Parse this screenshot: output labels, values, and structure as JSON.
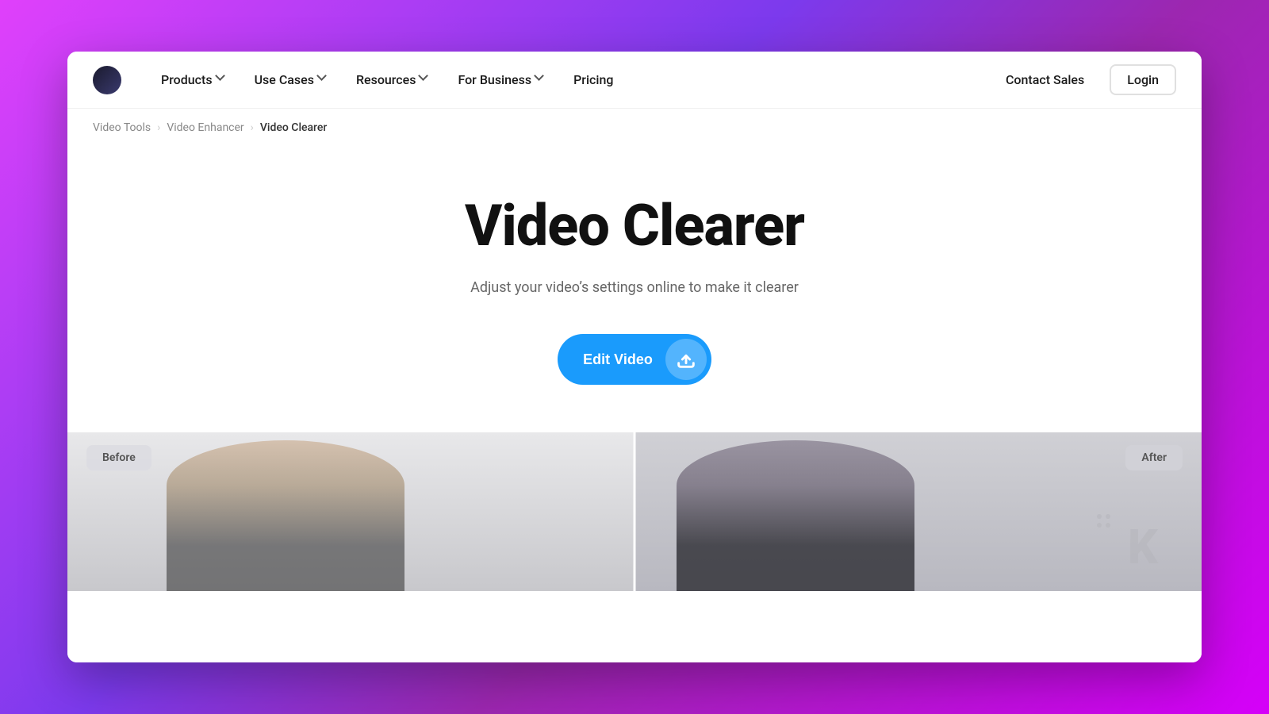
{
  "page": {
    "title": "Video Clearer"
  },
  "navbar": {
    "logo_alt": "App Logo",
    "links": [
      {
        "label": "Products",
        "has_dropdown": true
      },
      {
        "label": "Use Cases",
        "has_dropdown": true
      },
      {
        "label": "Resources",
        "has_dropdown": true
      },
      {
        "label": "For Business",
        "has_dropdown": true
      },
      {
        "label": "Pricing",
        "has_dropdown": false
      }
    ],
    "contact_sales_label": "Contact Sales",
    "login_label": "Login"
  },
  "breadcrumb": {
    "items": [
      {
        "label": "Video Tools",
        "active": false
      },
      {
        "label": "Video Enhancer",
        "active": false
      },
      {
        "label": "Video Clearer",
        "active": true
      }
    ]
  },
  "hero": {
    "title": "Video Clearer",
    "subtitle": "Adjust your video’s settings online to make it clearer",
    "cta_label": "Edit Video"
  },
  "before_after": {
    "before_label": "Before",
    "after_label": "After"
  },
  "colors": {
    "cta_bg": "#1a9bfc",
    "background_gradient_start": "#e040fb",
    "background_gradient_end": "#d500f9"
  }
}
